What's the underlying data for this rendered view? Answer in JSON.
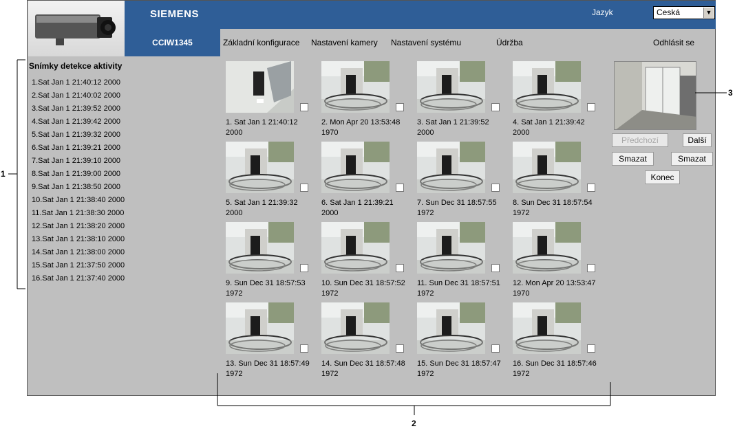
{
  "header": {
    "brand": "SIEMENS",
    "model": "CCIW1345",
    "language_label": "Jazyk",
    "language_value": "Ceská"
  },
  "nav": {
    "items": [
      "Základní konfigurace",
      "Nastavení kamery",
      "Nastavení systému",
      "Údržba"
    ],
    "logout": "Odhlásit se"
  },
  "sidebar": {
    "title": "Snímky detekce aktivity",
    "items": [
      "1.Sat Jan 1 21:40:12 2000",
      "2.Sat Jan 1 21:40:02 2000",
      "3.Sat Jan 1 21:39:52 2000",
      "4.Sat Jan 1 21:39:42 2000",
      "5.Sat Jan 1 21:39:32 2000",
      "6.Sat Jan 1 21:39:21 2000",
      "7.Sat Jan 1 21:39:10 2000",
      "8.Sat Jan 1 21:39:00 2000",
      "9.Sat Jan 1 21:38:50 2000",
      "10.Sat Jan 1 21:38:40 2000",
      "11.Sat Jan 1 21:38:30 2000",
      "12.Sat Jan 1 21:38:20 2000",
      "13.Sat Jan 1 21:38:10 2000",
      "14.Sat Jan 1 21:38:00 2000",
      "15.Sat Jan 1 21:37:50 2000",
      "16.Sat Jan 1 21:37:40 2000"
    ]
  },
  "thumbnails": [
    {
      "line1": "1. Sat Jan 1 21:40:12",
      "line2": "2000"
    },
    {
      "line1": "2. Mon Apr 20 13:53:48",
      "line2": "1970"
    },
    {
      "line1": "3. Sat Jan 1 21:39:52",
      "line2": "2000"
    },
    {
      "line1": "4. Sat Jan 1 21:39:42",
      "line2": "2000"
    },
    {
      "line1": "5. Sat Jan 1 21:39:32",
      "line2": "2000"
    },
    {
      "line1": "6. Sat Jan 1 21:39:21",
      "line2": "2000"
    },
    {
      "line1": "7. Sun Dec 31 18:57:55",
      "line2": "1972"
    },
    {
      "line1": "8. Sun Dec 31 18:57:54",
      "line2": "1972"
    },
    {
      "line1": "9. Sun Dec 31 18:57:53",
      "line2": "1972"
    },
    {
      "line1": "10. Sun Dec 31 18:57:52",
      "line2": "1972"
    },
    {
      "line1": "11. Sun Dec 31 18:57:51",
      "line2": "1972"
    },
    {
      "line1": "12. Mon Apr 20 13:53:47",
      "line2": "1970"
    },
    {
      "line1": "13. Sun Dec 31 18:57:49",
      "line2": "1972"
    },
    {
      "line1": "14. Sun Dec 31 18:57:48",
      "line2": "1972"
    },
    {
      "line1": "15. Sun Dec 31 18:57:47",
      "line2": "1972"
    },
    {
      "line1": "16. Sun Dec 31 18:57:46",
      "line2": "1972"
    }
  ],
  "controls": {
    "prev": "Předchozí",
    "next": "Další",
    "delete_left": "Smazat",
    "delete_right": "Smazat",
    "end": "Konec"
  },
  "callouts": {
    "one": "1",
    "two": "2",
    "three": "3"
  },
  "colors": {
    "header_blue": "#2f5e97",
    "panel_gray": "#bfbfbf"
  }
}
